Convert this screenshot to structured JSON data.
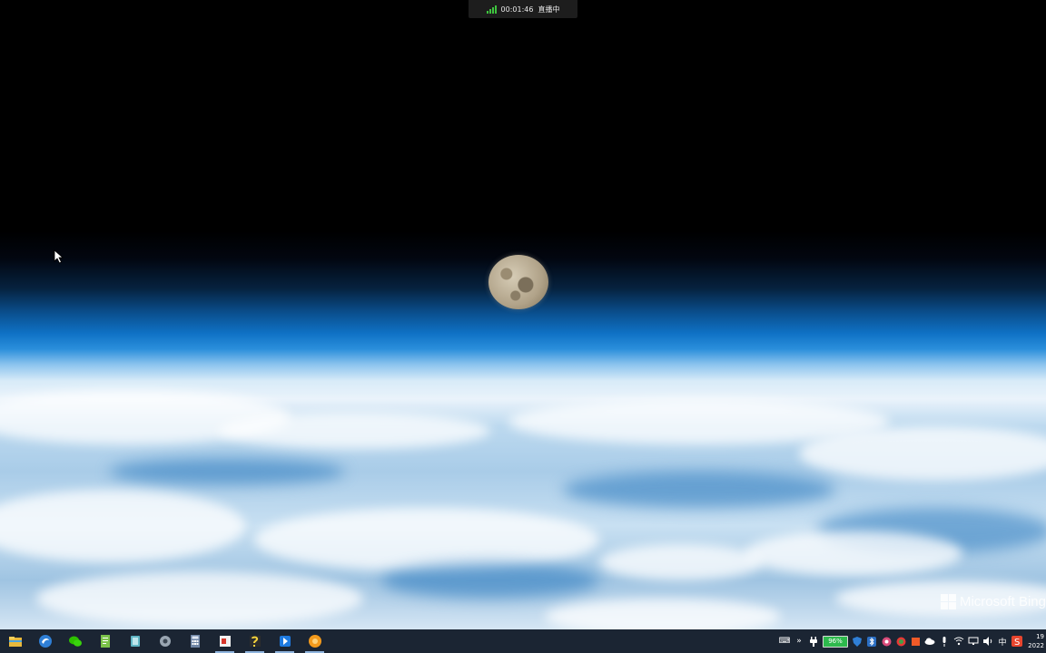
{
  "live_indicator": {
    "timer": "00:01:46",
    "status": "直播中",
    "signal_color": "#3ec43e"
  },
  "wallpaper": {
    "watermark": "Microsoft Bing"
  },
  "taskbar": {
    "apps": [
      {
        "name": "file-explorer-icon",
        "active": false
      },
      {
        "name": "browser-icon",
        "active": false
      },
      {
        "name": "wechat-icon",
        "active": false
      },
      {
        "name": "notepad-icon",
        "active": false
      },
      {
        "name": "app-icon",
        "active": false
      },
      {
        "name": "tool-icon",
        "active": false
      },
      {
        "name": "calculator-icon",
        "active": false
      },
      {
        "name": "presentation-icon",
        "active": true
      },
      {
        "name": "script-icon",
        "active": true
      },
      {
        "name": "app-blue-icon",
        "active": true
      },
      {
        "name": "orange-app-icon",
        "active": true
      }
    ],
    "tray": {
      "keyboard_label": "⌨",
      "chevron": "»",
      "battery_percent": "96%",
      "ime_label": "中",
      "clock_time": "19",
      "clock_date": "2022"
    }
  },
  "colors": {
    "taskbar_bg": "#1b2533",
    "battery_fill": "#2db94d",
    "live_bg": "#1d1d1d"
  }
}
